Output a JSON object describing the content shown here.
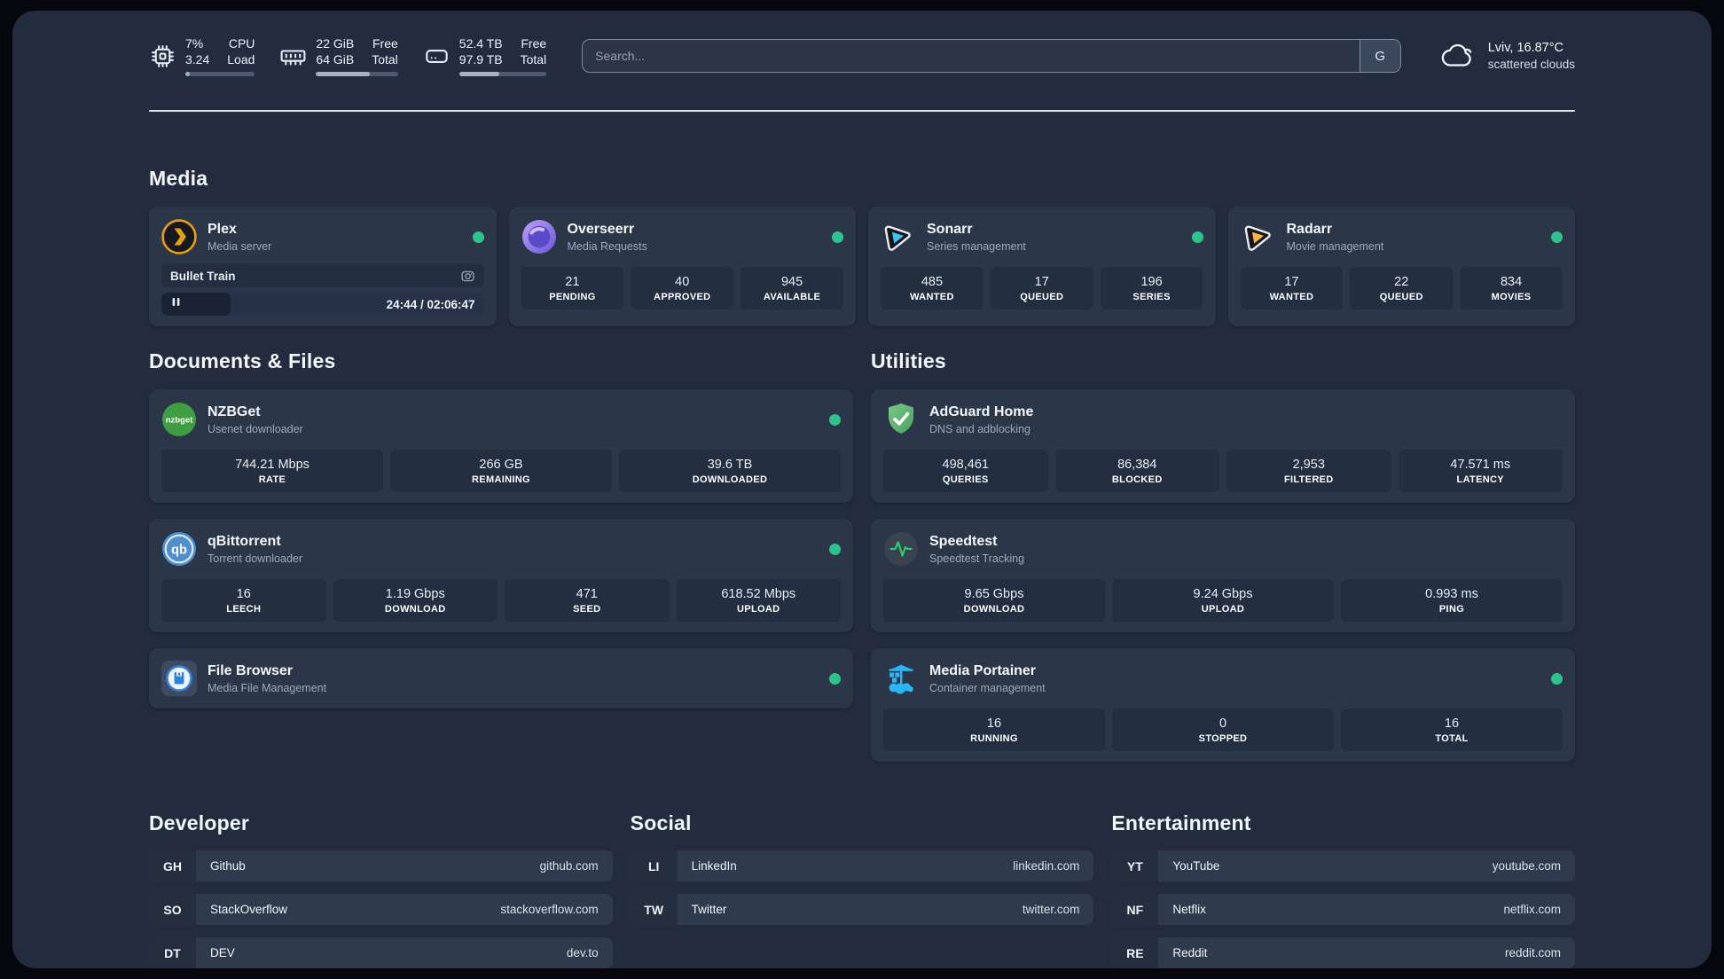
{
  "colors": {
    "app_background": "#222c3e",
    "card_background": "#2b3648",
    "stat_box_background": "#232e40",
    "status_online": "#2bc48a",
    "plex_amber": "#e5a00d",
    "sonarr_blue": "#38c5f4",
    "radarr_orange": "#ffb53c",
    "nzbget_green": "#3f9e42",
    "qbittorrent_blue": "#4f8fd0",
    "adguard_green": "#5cb26d",
    "speedtest_pulse": "#2ecc71",
    "portainer_blue": "#29b6f6",
    "filebrowser_blue": "#2f7fe0"
  },
  "header": {
    "system_stats": [
      {
        "id": "cpu",
        "icon": "cpu-icon",
        "line1": {
          "value": "7%",
          "label": "CPU"
        },
        "line2": {
          "value": "3.24",
          "label": "Load"
        },
        "progress_pct": 7
      },
      {
        "id": "memory",
        "icon": "ram-icon",
        "line1": {
          "value": "22 GiB",
          "label": "Free"
        },
        "line2": {
          "value": "64 GiB",
          "label": "Total"
        },
        "progress_pct": 66
      },
      {
        "id": "storage",
        "icon": "disk-icon",
        "line1": {
          "value": "52.4 TB",
          "label": "Free"
        },
        "line2": {
          "value": "97.9 TB",
          "label": "Total"
        },
        "progress_pct": 46
      }
    ],
    "search": {
      "placeholder": "Search...",
      "provider_label": "G"
    },
    "weather": {
      "location": "Lviv, 16.87°C",
      "condition": "scattered clouds"
    }
  },
  "sections": {
    "media": {
      "title": "Media",
      "cards": [
        {
          "id": "plex",
          "name": "Plex",
          "description": "Media server",
          "icon": "plex-icon",
          "online": true,
          "now_playing": {
            "title": "Bullet Train",
            "time_display": "24:44 / 02:06:47",
            "progress_pct": 19,
            "state": "paused"
          }
        },
        {
          "id": "overseerr",
          "name": "Overseerr",
          "description": "Media Requests",
          "icon": "overseerr-icon",
          "online": true,
          "stats": [
            {
              "value": "21",
              "label": "PENDING"
            },
            {
              "value": "40",
              "label": "APPROVED"
            },
            {
              "value": "945",
              "label": "AVAILABLE"
            }
          ]
        },
        {
          "id": "sonarr",
          "name": "Sonarr",
          "description": "Series management",
          "icon": "sonarr-icon",
          "online": true,
          "stats": [
            {
              "value": "485",
              "label": "WANTED"
            },
            {
              "value": "17",
              "label": "QUEUED"
            },
            {
              "value": "196",
              "label": "SERIES"
            }
          ]
        },
        {
          "id": "radarr",
          "name": "Radarr",
          "description": "Movie management",
          "icon": "radarr-icon",
          "online": true,
          "stats": [
            {
              "value": "17",
              "label": "WANTED"
            },
            {
              "value": "22",
              "label": "QUEUED"
            },
            {
              "value": "834",
              "label": "MOVIES"
            }
          ]
        }
      ]
    },
    "documents": {
      "title": "Documents & Files",
      "cards": [
        {
          "id": "nzbget",
          "name": "NZBGet",
          "description": "Usenet downloader",
          "icon": "nzbget-icon",
          "online": true,
          "stats": [
            {
              "value": "744.21 Mbps",
              "label": "RATE"
            },
            {
              "value": "266 GB",
              "label": "REMAINING"
            },
            {
              "value": "39.6 TB",
              "label": "DOWNLOADED"
            }
          ]
        },
        {
          "id": "qbittorrent",
          "name": "qBittorrent",
          "description": "Torrent downloader",
          "icon": "qbittorrent-icon",
          "online": true,
          "stats": [
            {
              "value": "16",
              "label": "LEECH"
            },
            {
              "value": "1.19 Gbps",
              "label": "DOWNLOAD"
            },
            {
              "value": "471",
              "label": "SEED"
            },
            {
              "value": "618.52 Mbps",
              "label": "UPLOAD"
            }
          ]
        },
        {
          "id": "filebrowser",
          "name": "File Browser",
          "description": "Media File Management",
          "icon": "filebrowser-icon",
          "online": true
        }
      ]
    },
    "utilities": {
      "title": "Utilities",
      "cards": [
        {
          "id": "adguard",
          "name": "AdGuard Home",
          "description": "DNS and adblocking",
          "icon": "adguard-icon",
          "online": false,
          "stats": [
            {
              "value": "498,461",
              "label": "QUERIES"
            },
            {
              "value": "86,384",
              "label": "BLOCKED"
            },
            {
              "value": "2,953",
              "label": "FILTERED"
            },
            {
              "value": "47.571 ms",
              "label": "LATENCY"
            }
          ]
        },
        {
          "id": "speedtest",
          "name": "Speedtest",
          "description": "Speedtest Tracking",
          "icon": "speedtest-icon",
          "online": false,
          "stats": [
            {
              "value": "9.65 Gbps",
              "label": "DOWNLOAD"
            },
            {
              "value": "9.24 Gbps",
              "label": "UPLOAD"
            },
            {
              "value": "0.993 ms",
              "label": "PING"
            }
          ]
        },
        {
          "id": "portainer",
          "name": "Media Portainer",
          "description": "Container management",
          "icon": "portainer-icon",
          "online": true,
          "stats": [
            {
              "value": "16",
              "label": "RUNNING"
            },
            {
              "value": "0",
              "label": "STOPPED"
            },
            {
              "value": "16",
              "label": "TOTAL"
            }
          ]
        }
      ]
    }
  },
  "link_sections": [
    {
      "title": "Developer",
      "items": [
        {
          "abbr": "GH",
          "name": "Github",
          "url": "github.com"
        },
        {
          "abbr": "SO",
          "name": "StackOverflow",
          "url": "stackoverflow.com"
        },
        {
          "abbr": "DT",
          "name": "DEV",
          "url": "dev.to"
        }
      ]
    },
    {
      "title": "Social",
      "items": [
        {
          "abbr": "LI",
          "name": "LinkedIn",
          "url": "linkedin.com"
        },
        {
          "abbr": "TW",
          "name": "Twitter",
          "url": "twitter.com"
        }
      ]
    },
    {
      "title": "Entertainment",
      "items": [
        {
          "abbr": "YT",
          "name": "YouTube",
          "url": "youtube.com"
        },
        {
          "abbr": "NF",
          "name": "Netflix",
          "url": "netflix.com"
        },
        {
          "abbr": "RE",
          "name": "Reddit",
          "url": "reddit.com"
        }
      ]
    }
  ]
}
